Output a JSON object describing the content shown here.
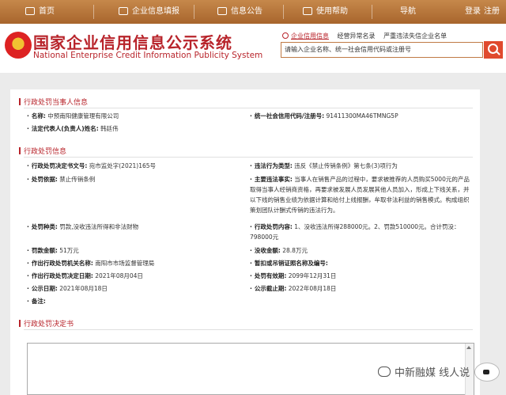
{
  "nav": {
    "home": "首页",
    "report": "企业信息填报",
    "announcement": "信息公告",
    "help": "使用帮助",
    "guide": "导航",
    "login": "登录",
    "register": "注册"
  },
  "header": {
    "title_cn": "国家企业信用信息公示系统",
    "title_en": "National Enterprise Credit Information Publicity System"
  },
  "search": {
    "tabs": [
      "企业信用信息",
      "经营异常名录",
      "严重违法失信企业名单"
    ],
    "placeholder": "请输入企业名称、统一社会信用代码或注册号"
  },
  "party": {
    "section_title": "行政处罚当事人信息",
    "name_label": "名称:",
    "name_value": "中预南阳健康管理有限公司",
    "credit_code_label": "统一社会信用代码/注册号:",
    "credit_code_value": "91411300MA46TMNG5P",
    "legal_rep_label": "法定代表人(负责人)姓名:",
    "legal_rep_value": "韩廷伟"
  },
  "penalty": {
    "section_title": "行政处罚信息",
    "doc_no_label": "行政处罚决定书文号:",
    "doc_no_value": "宛市监处字(2021)165号",
    "violation_type_label": "违法行为类型:",
    "violation_type_value": "违反《禁止传销条例》第七条(3)项行为",
    "basis_label": "处罚依据:",
    "basis_value": "禁止传销条例",
    "facts_label": "主要违法事实:",
    "facts_value": "当事人在销售产品的过程中，要求被推荐的人员购买5000元的产品取得当事人经销商资格，再要求被发展人员发展其他人员加入，形成上下线关系，并以下线的销售业绩为依据计算和给付上线报酬，牟取非法利益的销售模式。构成组织策划团队计酬式传销的违法行为。",
    "kind_label": "处罚种类:",
    "kind_value": "罚款,没收违法所得和非法财物",
    "content_label": "行政处罚内容:",
    "content_value": "1、没收违法所得288000元。2、罚款510000元。合计罚没：798000元",
    "fine_label": "罚款金额:",
    "fine_value": "51万元",
    "confiscation_label": "没收金额:",
    "confiscation_value": "28.8万元",
    "authority_label": "作出行政处罚机关名称:",
    "authority_value": "南阳市市场监督管理局",
    "license_label": "暂扣或吊销证照名称及编号:",
    "license_value": "",
    "decision_date_label": "作出行政处罚决定日期:",
    "decision_date_value": "2021年08月04日",
    "valid_until_label": "处罚有效期:",
    "valid_until_value": "2099年12月31日",
    "publish_date_label": "公示日期:",
    "publish_date_value": "2021年08月18日",
    "publish_end_label": "公示截止期:",
    "publish_end_value": "2022年08月18日",
    "remarks_label": "备注:",
    "remarks_value": ""
  },
  "decision": {
    "section_title": "行政处罚决定书"
  },
  "watermark": {
    "text": "中新融媒 线人说"
  },
  "colors": {
    "brand_red": "#b8242b",
    "topbar": "#a8652d",
    "search_button": "#e04a2e"
  }
}
